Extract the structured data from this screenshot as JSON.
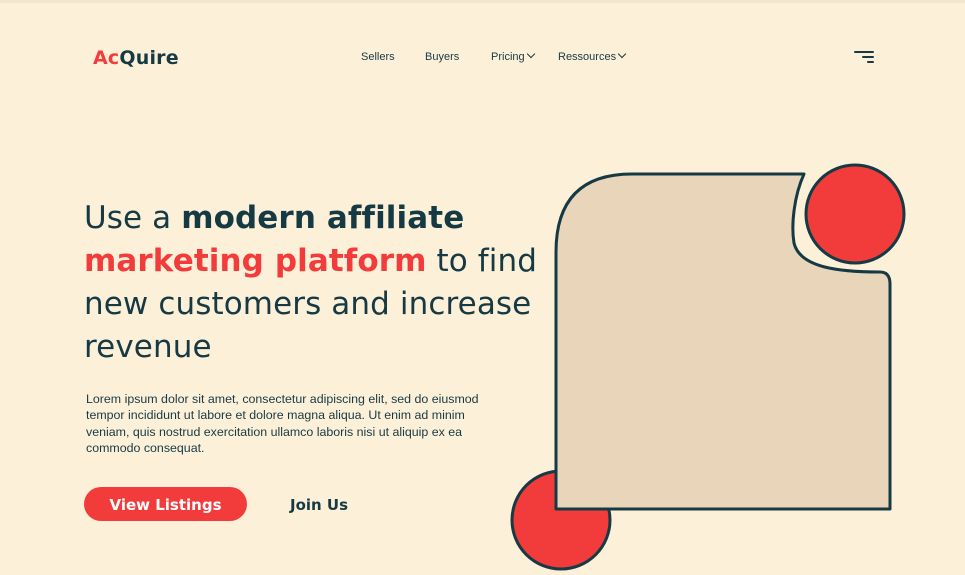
{
  "brand": {
    "logo_part1": "Ac",
    "logo_part2": "Quire",
    "accent_color": "#f23b3b",
    "text_color": "#163a44",
    "background_color": "#fdf0d9",
    "card_color": "#e8d5ba"
  },
  "nav": {
    "items": [
      {
        "label": "Sellers",
        "has_dropdown": false
      },
      {
        "label": "Buyers",
        "has_dropdown": false
      },
      {
        "label": "Pricing",
        "has_dropdown": true
      },
      {
        "label": "Ressources",
        "has_dropdown": true
      }
    ],
    "menu_icon": "hamburger-menu-icon"
  },
  "hero": {
    "headline_part1": "Use a ",
    "headline_bold": "modern affiliate",
    "headline_accent": "marketing platform",
    "headline_part2": " to find new customers and increase revenue",
    "description": "Lorem ipsum dolor sit amet, consectetur adipiscing elit, sed do eiusmod tempor incididunt ut labore et dolore magna aliqua. Ut enim ad minim veniam, quis nostrud exercitation ullamco laboris nisi ut aliquip ex ea commodo consequat.",
    "primary_button": "View Listings",
    "secondary_button": "Join Us"
  }
}
